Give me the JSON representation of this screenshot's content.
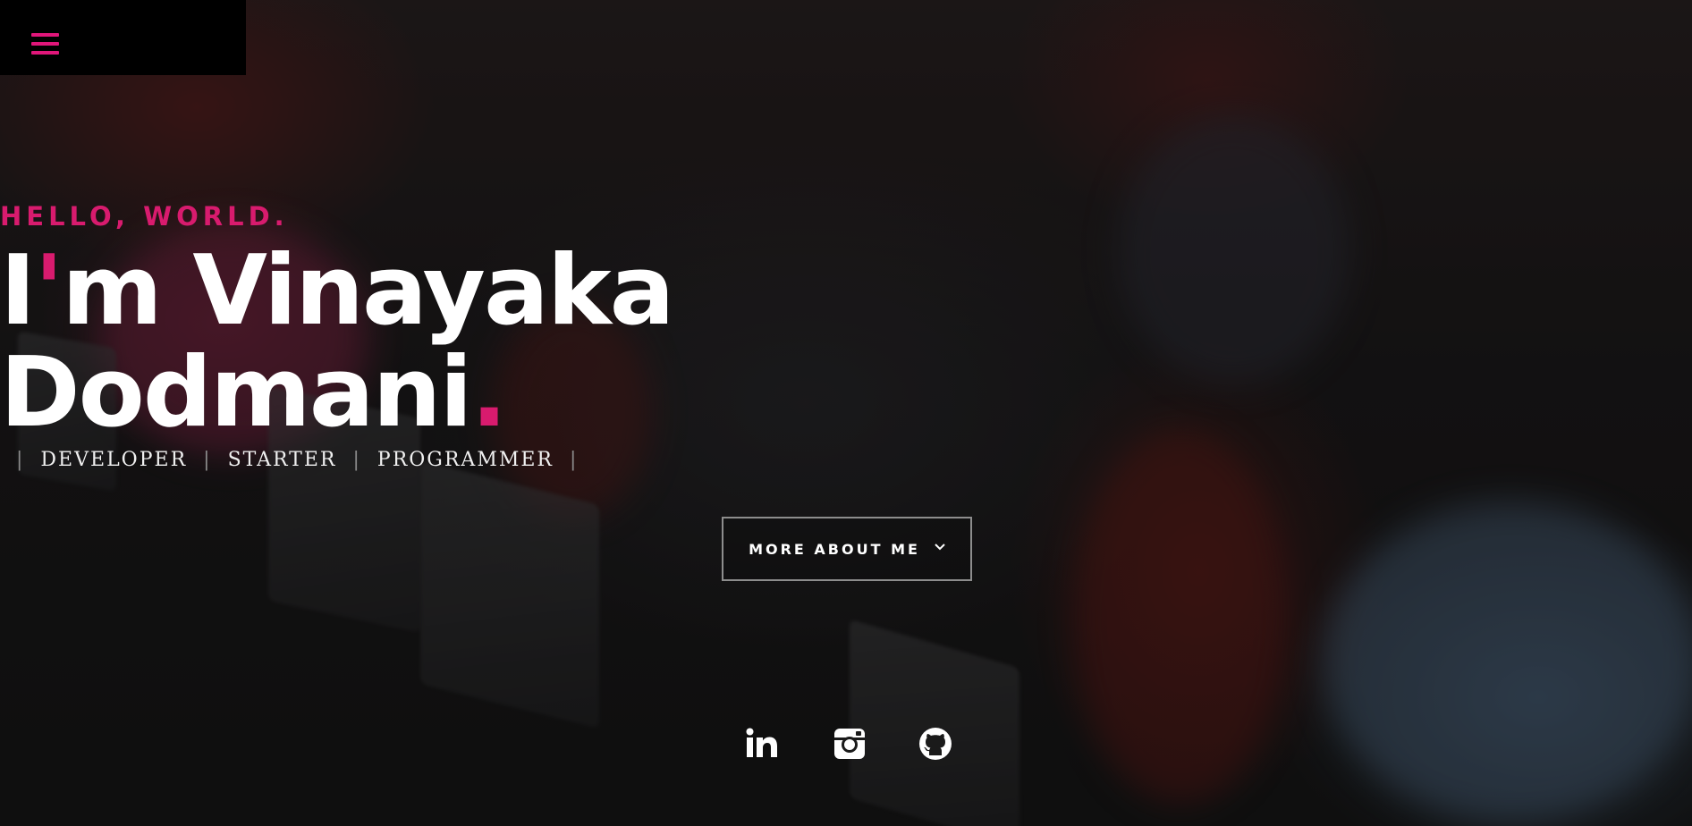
{
  "menu": {
    "icon": "hamburger-menu-icon"
  },
  "hero": {
    "greeting": "HELLO, WORLD.",
    "name_line1_first": "I",
    "name_line1_accent": "'",
    "name_line1_rest": "m Vinayaka",
    "name_line2": "Dodmani",
    "name_line2_dot": ".",
    "roles": [
      "DEVELOPER",
      "STARTER",
      "PROGRAMMER"
    ],
    "separator": "|",
    "button_label": "MORE ABOUT ME",
    "button_icon": "chevron-down-icon"
  },
  "social": [
    {
      "name": "linkedin",
      "icon": "linkedin-icon"
    },
    {
      "name": "instagram",
      "icon": "instagram-icon"
    },
    {
      "name": "github",
      "icon": "github-icon"
    }
  ],
  "colors": {
    "accent": "#d81b6e",
    "text": "#ffffff",
    "menu_bg": "#000000"
  }
}
